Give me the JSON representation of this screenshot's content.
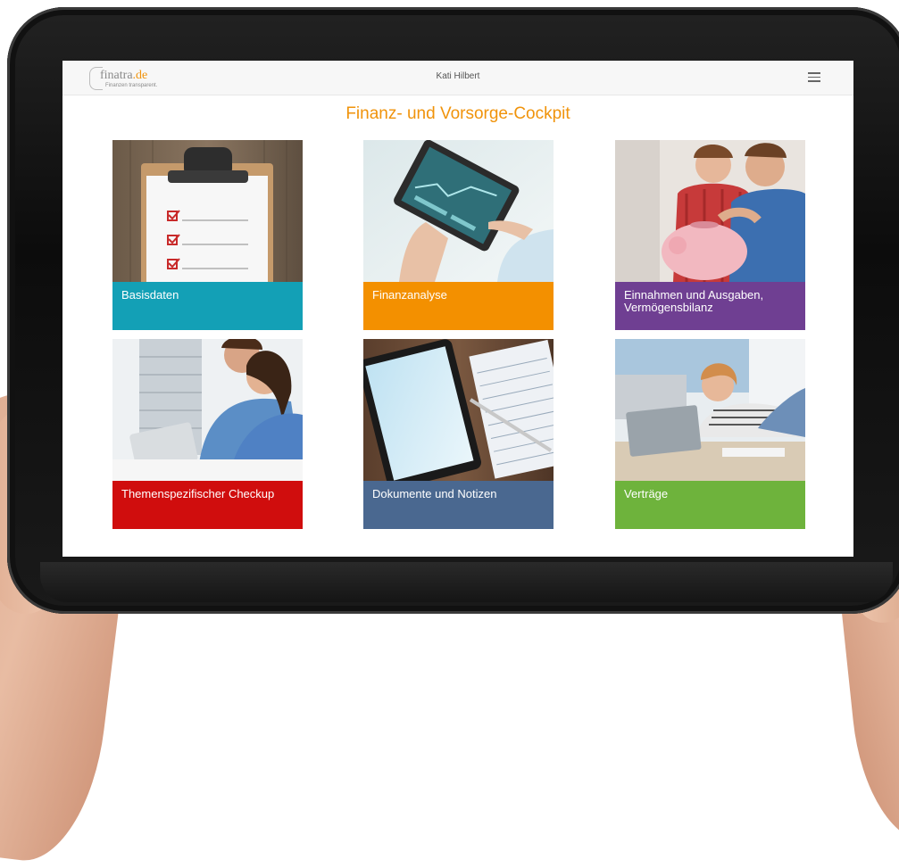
{
  "app": {
    "logo_text": "finatra.de",
    "logo_tagline": "Finanzen transparent.",
    "user_name": "Kati Hilbert"
  },
  "main": {
    "title": "Finanz- und Vorsorge-Cockpit"
  },
  "tiles": [
    {
      "label": "Basisdaten",
      "color": "#13a0b6"
    },
    {
      "label": "Finanzanalyse",
      "color": "#f39000"
    },
    {
      "label": "Einnahmen und Ausgaben, Vermögensbilanz",
      "color": "#6f3f92"
    },
    {
      "label": "Themenspezifischer Checkup",
      "color": "#d00d0d"
    },
    {
      "label": "Dokumente und Notizen",
      "color": "#4a6890"
    },
    {
      "label": "Verträge",
      "color": "#6eb33c"
    }
  ],
  "colors": {
    "accent": "#f0930b",
    "tablet_frame": "#111111"
  }
}
